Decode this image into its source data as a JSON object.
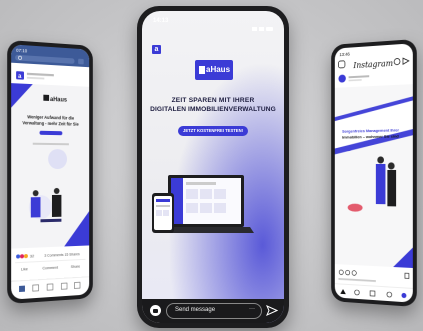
{
  "center": {
    "time": "14:13",
    "brand": "aHaus",
    "headline1": "ZEIT SPAREN MIT IHRER",
    "headline2": "DIGITALEN IMMOBILIENVERWALTUNG",
    "cta": "JETZT KOSTENFREI TESTEN!",
    "message_placeholder": "Send message",
    "more": "···"
  },
  "left": {
    "time": "07:10",
    "brand": "aHaus",
    "tagline1": "Weniger Aufwand für die",
    "tagline2": "Verwaltung - mehr Zeit für Sie",
    "reactions": "32",
    "comments": "3 Comments 15 Shares",
    "like": "Like",
    "comment": "Comment",
    "share": "Share"
  },
  "right": {
    "time": "13:46",
    "app": "Instagram",
    "caption1": "Sorgenfreies Management Ihrer",
    "caption2": "Immobilien – wohnmer Sie sind"
  },
  "colors": {
    "accent": "#3b3bd6",
    "dark": "#1d1d1f"
  }
}
